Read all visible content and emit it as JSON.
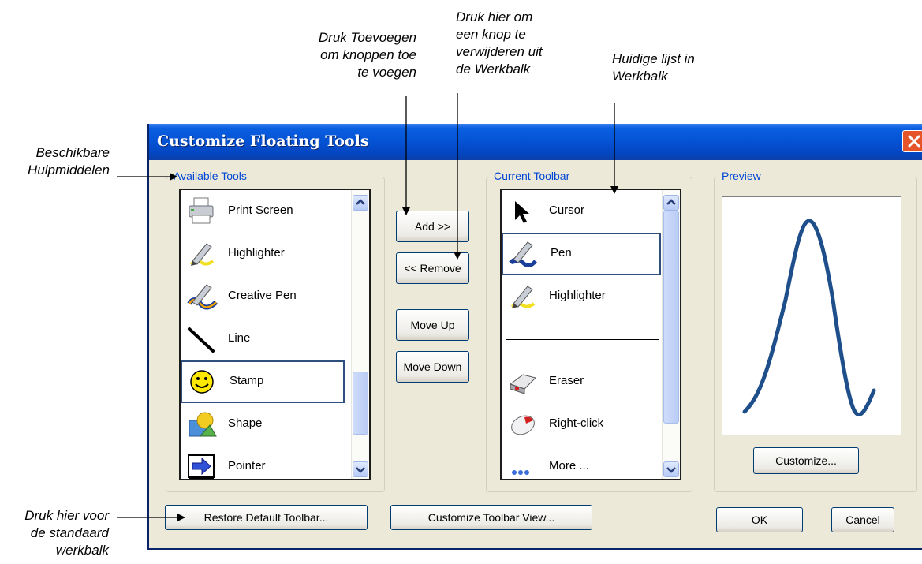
{
  "annotations": {
    "add_hint": "Druk Toevoegen\nom knoppen toe\nte voegen",
    "remove_hint": "Druk hier om\neen knop te\nverwijderen uit\nde Werkbalk",
    "current_hint": "Huidige lijst in\nWerkbalk",
    "available_hint": "Beschikbare\nHulpmiddelen",
    "restore_hint": "Druk hier voor\nde  standaard\nwerkbalk"
  },
  "dialog": {
    "title": "Customize Floating Tools",
    "available_group_label": "Available Tools",
    "current_group_label": "Current Toolbar",
    "preview_group_label": "Preview"
  },
  "available_tools": [
    {
      "label": "Print Screen",
      "icon": "printer-icon"
    },
    {
      "label": "Highlighter",
      "icon": "highlighter-icon"
    },
    {
      "label": "Creative Pen",
      "icon": "creative-pen-icon"
    },
    {
      "label": "Line",
      "icon": "line-icon"
    },
    {
      "label": "Stamp",
      "icon": "smiley-stamp-icon",
      "selected": true
    },
    {
      "label": "Shape",
      "icon": "shape-icon"
    },
    {
      "label": "Pointer",
      "icon": "pointer-arrow-icon"
    }
  ],
  "current_toolbar": [
    {
      "label": "Cursor",
      "icon": "cursor-icon"
    },
    {
      "label": "Pen",
      "icon": "pen-icon",
      "selected": true
    },
    {
      "label": "Highlighter",
      "icon": "highlighter-icon"
    },
    {
      "label": "",
      "icon": "separator-line"
    },
    {
      "label": "Eraser",
      "icon": "eraser-icon"
    },
    {
      "label": "Right-click",
      "icon": "mouse-icon"
    },
    {
      "label": "More ...",
      "icon": "more-dots-icon"
    }
  ],
  "buttons": {
    "add": "Add >>",
    "remove": "<< Remove",
    "move_up": "Move Up",
    "move_down": "Move Down",
    "customize": "Customize...",
    "restore": "Restore Default Toolbar...",
    "customize_view": "Customize Toolbar View...",
    "ok": "OK",
    "cancel": "Cancel"
  },
  "colors": {
    "title_bar": "#0554d6",
    "dialog_bg": "#ece9d8",
    "group_label": "#0046d5",
    "preview_curve": "#1f4f8a",
    "close_button": "#e6542a"
  }
}
